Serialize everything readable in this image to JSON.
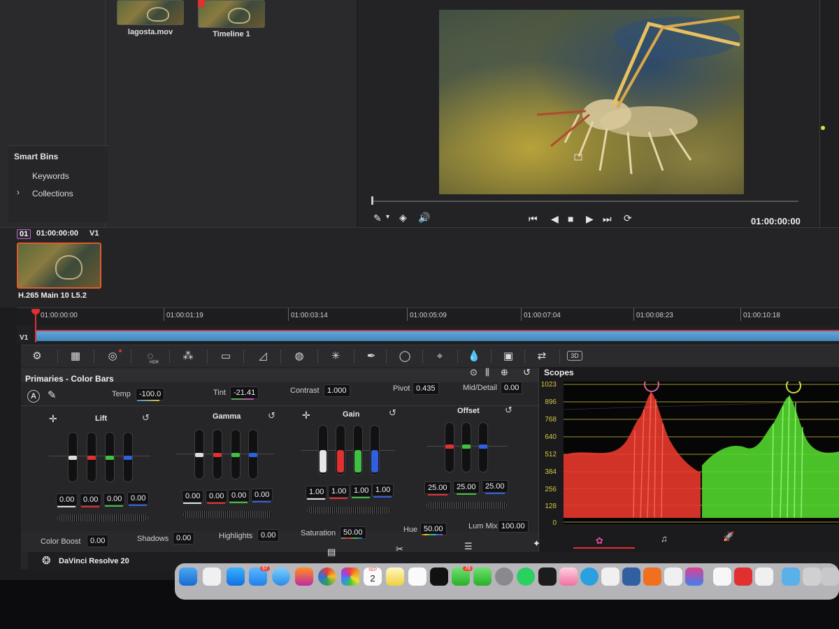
{
  "media_pool": {
    "clips": [
      {
        "label": "lagosta.mov"
      },
      {
        "label": "Timeline 1"
      }
    ],
    "smart_bins": {
      "title": "Smart Bins",
      "items": [
        {
          "label": "Keywords"
        },
        {
          "label": "Collections"
        }
      ]
    }
  },
  "viewer": {
    "timecode": "01:00:00:00"
  },
  "clip_strip": {
    "index": "01",
    "timecode": "01:00:00:00",
    "track": "V1",
    "codec": "H.265 Main 10 L5.2"
  },
  "timeline": {
    "track_label": "V1",
    "ruler": [
      "01:00:00:00",
      "01:00:01:19",
      "01:00:03:14",
      "01:00:05:09",
      "01:00:07:04",
      "01:00:08:23",
      "01:00:10:18"
    ]
  },
  "toolbar": {
    "hdr_label": "HDR",
    "three_d_label": "3D"
  },
  "primaries": {
    "title": "Primaries - Color Bars",
    "auto_label": "A",
    "temp": {
      "label": "Temp",
      "value": "-100.0"
    },
    "tint": {
      "label": "Tint",
      "value": "-21.41"
    },
    "contrast": {
      "label": "Contrast",
      "value": "1.000"
    },
    "pivot": {
      "label": "Pivot",
      "value": "0.435"
    },
    "mid_detail": {
      "label": "Mid/Detail",
      "value": "0.00"
    },
    "wheels": [
      {
        "title": "Lift",
        "values": [
          "0.00",
          "0.00",
          "0.00",
          "0.00"
        ]
      },
      {
        "title": "Gamma",
        "values": [
          "0.00",
          "0.00",
          "0.00",
          "0.00"
        ]
      },
      {
        "title": "Gain",
        "values": [
          "1.00",
          "1.00",
          "1.00",
          "1.00"
        ]
      },
      {
        "title": "Offset",
        "values": [
          "25.00",
          "25.00",
          "25.00"
        ]
      }
    ],
    "color_boost": {
      "label": "Color Boost",
      "value": "0.00"
    },
    "shadows": {
      "label": "Shadows",
      "value": "0.00"
    },
    "highlights": {
      "label": "Highlights",
      "value": "0.00"
    },
    "saturation": {
      "label": "Saturation",
      "value": "50.00"
    },
    "hue": {
      "label": "Hue",
      "value": "50.00"
    },
    "lum_mix": {
      "label": "Lum Mix",
      "value": "100.00"
    }
  },
  "scopes": {
    "title": "Scopes",
    "scale": [
      "1023",
      "896",
      "768",
      "640",
      "512",
      "384",
      "256",
      "128",
      "0"
    ]
  },
  "app": {
    "name": "DaVinci Resolve 20"
  },
  "dock": {
    "mail_badge": "67",
    "calendar_month": "SEP",
    "calendar_day": "2",
    "messages_badge": "78"
  },
  "colors": {
    "accent": "#e05a30",
    "playhead": "#e03030",
    "track": "#4a95c9",
    "scope_red": "#e8382c",
    "scope_green": "#53d62e",
    "scale": "#d8c640"
  }
}
